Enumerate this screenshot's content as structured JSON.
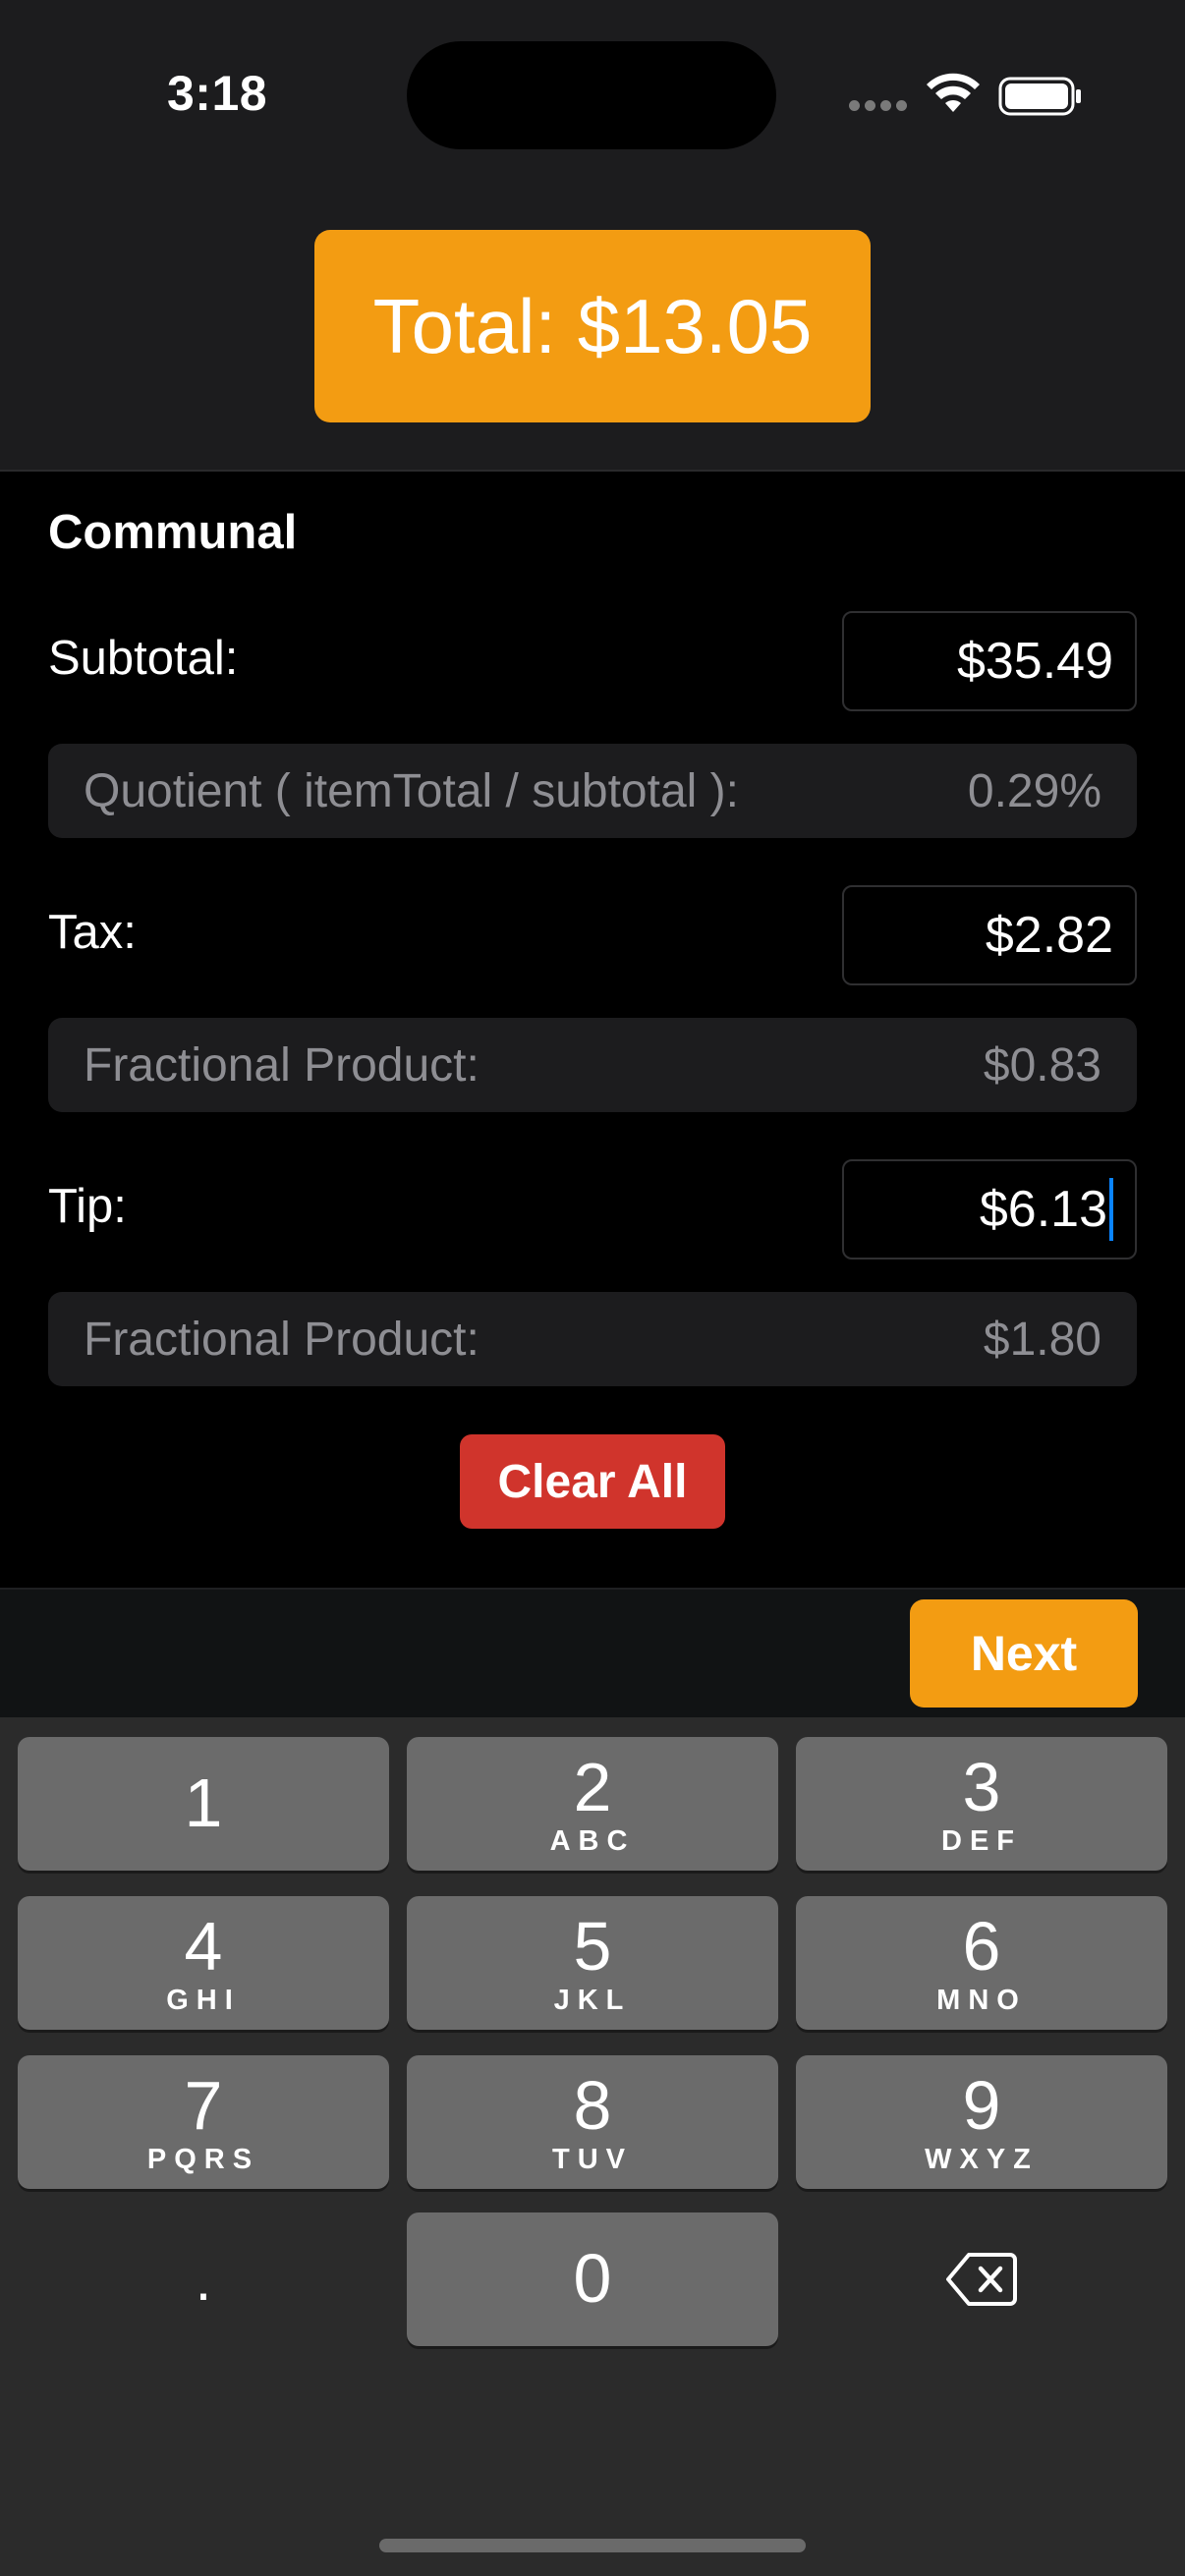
{
  "status_bar": {
    "time": "3:18"
  },
  "header": {
    "total_label": "Total: $13.05",
    "accent_color": "#f39c12"
  },
  "form": {
    "section_title": "Communal",
    "subtotal": {
      "label": "Subtotal:",
      "value": "$35.49"
    },
    "quotient": {
      "label": "Quotient ( itemTotal / subtotal ):",
      "value": "0.29%"
    },
    "tax": {
      "label": "Tax:",
      "value": "$2.82"
    },
    "tax_product": {
      "label": "Fractional Product:",
      "value": "$0.83"
    },
    "tip": {
      "label": "Tip:",
      "value": "$6.13"
    },
    "tip_product": {
      "label": "Fractional Product:",
      "value": "$1.80"
    },
    "clear_label": "Clear All",
    "clear_color": "#d0342c"
  },
  "accessory": {
    "next_label": "Next"
  },
  "keyboard": {
    "keys": [
      {
        "num": "1",
        "letters": ""
      },
      {
        "num": "2",
        "letters": "ABC"
      },
      {
        "num": "3",
        "letters": "DEF"
      },
      {
        "num": "4",
        "letters": "GHI"
      },
      {
        "num": "5",
        "letters": "JKL"
      },
      {
        "num": "6",
        "letters": "MNO"
      },
      {
        "num": "7",
        "letters": "PQRS"
      },
      {
        "num": "8",
        "letters": "TUV"
      },
      {
        "num": "9",
        "letters": "WXYZ"
      },
      {
        "num": "0",
        "letters": ""
      }
    ],
    "decimal": ".",
    "delete_icon": "backspace-icon"
  }
}
